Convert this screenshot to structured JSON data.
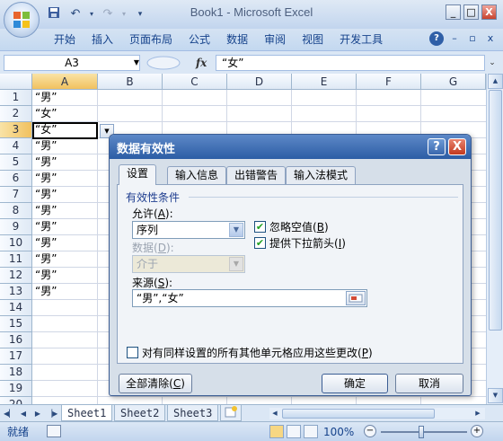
{
  "window": {
    "title": "Book1 - Microsoft Excel",
    "btn_min": "_",
    "btn_max": "□",
    "btn_close": "X"
  },
  "ribbon": {
    "tabs": [
      "开始",
      "插入",
      "页面布局",
      "公式",
      "数据",
      "审阅",
      "视图",
      "开发工具"
    ],
    "right_min": "–",
    "right_restore": "▫",
    "right_close": "x",
    "help": "?"
  },
  "formula_bar": {
    "name_box": "A3",
    "fx": "fx",
    "value": "“女”"
  },
  "grid": {
    "columns": [
      "A",
      "B",
      "C",
      "D",
      "E",
      "F",
      "G"
    ],
    "rows": [
      "1",
      "2",
      "3",
      "4",
      "5",
      "6",
      "7",
      "8",
      "9",
      "10",
      "11",
      "12",
      "13",
      "14",
      "15",
      "16",
      "17",
      "18",
      "19",
      "20"
    ],
    "column_A": [
      "“男”",
      "“女”",
      "“女”",
      "“男”",
      "“男”",
      "“男”",
      "“男”",
      "“男”",
      "“男”",
      "“男”",
      "“男”",
      "“男”",
      "“男”"
    ],
    "active_cell": "A3"
  },
  "sheets": {
    "tabs": [
      "Sheet1",
      "Sheet2",
      "Sheet3"
    ]
  },
  "status": {
    "ready": "就绪",
    "zoom": "100%",
    "zoom_minus": "−",
    "zoom_plus": "+"
  },
  "dialog": {
    "title": "数据有效性",
    "help": "?",
    "close": "X",
    "tabs": [
      "设置",
      "输入信息",
      "出错警告",
      "输入法模式"
    ],
    "group_label": "有效性条件",
    "allow_label": "允许",
    "allow_key": "A",
    "allow_value": "序列",
    "data_label": "数据",
    "data_key": "D",
    "data_value": "介于",
    "ignore_blank_label": "忽略空值",
    "ignore_blank_key": "B",
    "ignore_blank_checked": "✔",
    "dropdown_label": "提供下拉箭头",
    "dropdown_key": "I",
    "dropdown_checked": "✔",
    "source_label": "来源",
    "source_key": "S",
    "source_value": "“男”,“女”",
    "apply_all_label": "对有同样设置的所有其他单元格应用这些更改",
    "apply_all_key": "P",
    "clear_all_label": "全部清除",
    "clear_all_key": "C",
    "ok_label": "确定",
    "cancel_label": "取消"
  }
}
